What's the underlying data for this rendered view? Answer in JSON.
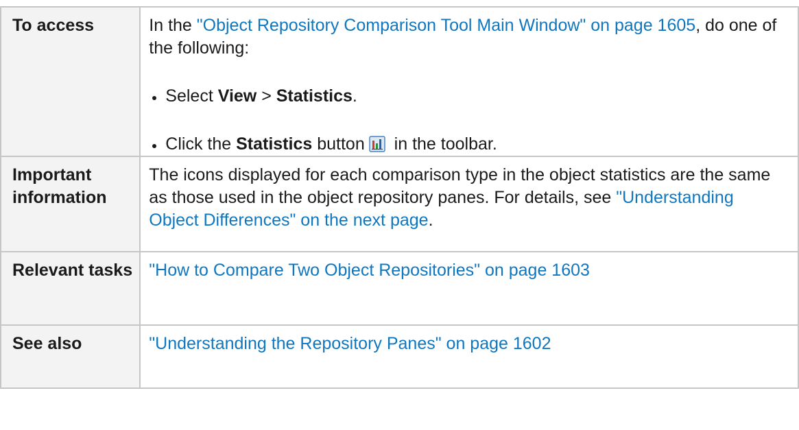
{
  "rows": {
    "access": {
      "label": "To access",
      "link": "\"Object Repository Comparison Tool Main Window\" on page 1605",
      "suffix": ", do one of the following:",
      "prefix": "In the ",
      "bullet1": {
        "pre": "Select ",
        "b1": "View",
        "mid": " > ",
        "b2": "Statistics",
        "post": "."
      },
      "bullet2": {
        "pre": "Click the ",
        "b": "Statistics",
        "mid": " button",
        "post": " in the toolbar.",
        "icon": "statistics-bar-chart-icon"
      }
    },
    "important": {
      "label": "Important information",
      "text": "The icons displayed for each comparison type in the object statistics are the same as those used in the object repository panes. For details, see ",
      "link": "\"Understanding Object Differences\" on the next page",
      "post": "."
    },
    "tasks": {
      "label": "Relevant tasks",
      "link": "\"How to Compare Two Object Repositories\" on page 1603"
    },
    "see_also": {
      "label": "See also",
      "link": "\"Understanding the Repository Panes\" on page 1602"
    }
  },
  "colors": {
    "link": "#0f77c0",
    "border": "#c6c6c6",
    "header_bg": "#f3f3f3"
  }
}
